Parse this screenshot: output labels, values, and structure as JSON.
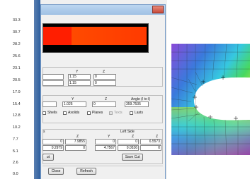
{
  "scale": {
    "ticks": [
      "33.3",
      "30.7",
      "28.2",
      "25.6",
      "23.1",
      "20.5",
      "17.9",
      "15.4",
      "12.8",
      "10.2",
      "7.7",
      "5.1",
      "2.6",
      "0.0"
    ]
  },
  "colorbar": {
    "accent_red": "#ff1e00",
    "accent_orange": "#ff4400"
  },
  "coords": {
    "header_y": "Y",
    "header_z": "Z",
    "row1_y": "1.15",
    "row1_z": "0",
    "row2_y": "1.15",
    "row2_z": "0"
  },
  "orientation": {
    "header_y": "Y",
    "header_z": "Z",
    "header_angle": "Angle (I to I)",
    "y_value": "1.025",
    "z_value": "0",
    "angle_value": "359.7535"
  },
  "display_options": {
    "shells": "Shells",
    "axolids": "Axolids",
    "planes": "Planes",
    "texts": "Texts",
    "lasts": "Lasts"
  },
  "cut_results": {
    "left_header": "s",
    "right_header": "Left Side",
    "left_cols": [
      "Z"
    ],
    "right_cols": [
      "Y",
      "Z",
      "Z"
    ],
    "row1_left": [
      "0",
      "7.9855"
    ],
    "row1_right": [
      "0",
      "0",
      "6.5573"
    ],
    "row2_left": [
      "0.2979",
      "0"
    ],
    "row2_right": [
      "4.7567",
      "0.0536",
      "0"
    ],
    "left_button": "ut",
    "save_button": "Save Cut"
  },
  "footer": {
    "close_button": "Close",
    "refresh_button": "Refresh"
  }
}
